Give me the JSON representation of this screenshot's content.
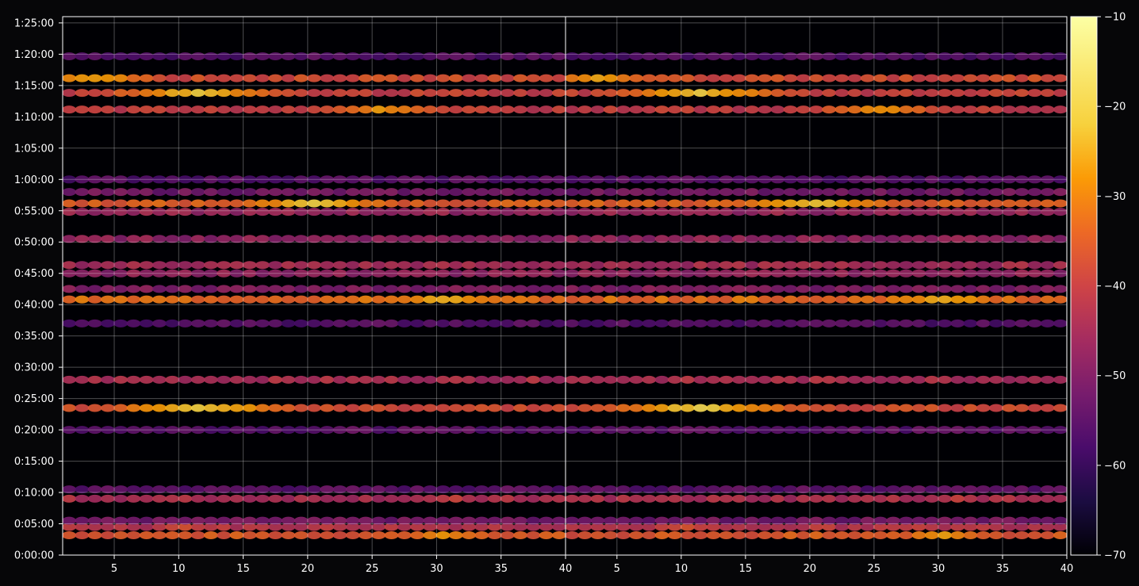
{
  "chart_data": {
    "type": "heatmap",
    "title": "",
    "xlabel": "",
    "ylabel": "",
    "panels": 2,
    "xlim": [
      1,
      40
    ],
    "x_ticks": [
      5,
      10,
      15,
      20,
      25,
      30,
      35,
      40
    ],
    "x_tick_labels": [
      "5",
      "10",
      "15",
      "20",
      "25",
      "30",
      "35",
      "40"
    ],
    "ylim_seconds": [
      0,
      5160
    ],
    "y_ticks": [
      0,
      300,
      600,
      900,
      1200,
      1500,
      1800,
      2100,
      2400,
      2700,
      3000,
      3300,
      3600,
      3900,
      4200,
      4500,
      4800,
      5100
    ],
    "y_tick_labels": [
      "0:00:00",
      "0:05:00",
      "0:10:00",
      "0:15:00",
      "0:20:00",
      "0:25:00",
      "0:30:00",
      "0:35:00",
      "0:40:00",
      "0:45:00",
      "0:50:00",
      "0:55:00",
      "1:00:00",
      "1:05:00",
      "1:10:00",
      "1:15:00",
      "1:20:00",
      "1:25:00"
    ],
    "grid": true,
    "colormap": "inferno",
    "colorbar": {
      "range": [
        -70,
        -10
      ],
      "ticks": [
        -10,
        -20,
        -30,
        -40,
        -50,
        -60,
        -70
      ],
      "tick_labels": [
        "−10",
        "−20",
        "−30",
        "−40",
        "−50",
        "−60",
        "−70"
      ]
    },
    "bands": [
      {
        "t": 190,
        "level": -36,
        "peak_x": 30,
        "peak_level": -28
      },
      {
        "t": 270,
        "level": -42,
        "peak_x": 10,
        "peak_level": -38
      },
      {
        "t": 330,
        "level": -52
      },
      {
        "t": 540,
        "level": -44,
        "peak_x": 31,
        "peak_level": -40
      },
      {
        "t": 630,
        "level": -55
      },
      {
        "t": 1200,
        "level": -55
      },
      {
        "t": 1410,
        "level": -38,
        "peak_x": 11,
        "peak_level": -20
      },
      {
        "t": 1680,
        "level": -44
      },
      {
        "t": 2220,
        "level": -56
      },
      {
        "t": 2450,
        "level": -33,
        "peak_x": 30,
        "peak_level": -24
      },
      {
        "t": 2550,
        "level": -50
      },
      {
        "t": 2700,
        "level": -48
      },
      {
        "t": 2780,
        "level": -45
      },
      {
        "t": 3030,
        "level": -48
      },
      {
        "t": 3290,
        "level": -47
      },
      {
        "t": 3370,
        "level": -35,
        "peak_x": 20,
        "peak_level": -22
      },
      {
        "t": 3480,
        "level": -52
      },
      {
        "t": 3600,
        "level": -56
      },
      {
        "t": 4270,
        "level": -41,
        "peak_x": 25,
        "peak_level": -28
      },
      {
        "t": 4430,
        "level": -40,
        "peak_x": 11,
        "peak_level": -22
      },
      {
        "t": 4570,
        "level": -38,
        "peak_x": 3,
        "peak_level": -26
      },
      {
        "t": 4780,
        "level": -56
      }
    ]
  }
}
